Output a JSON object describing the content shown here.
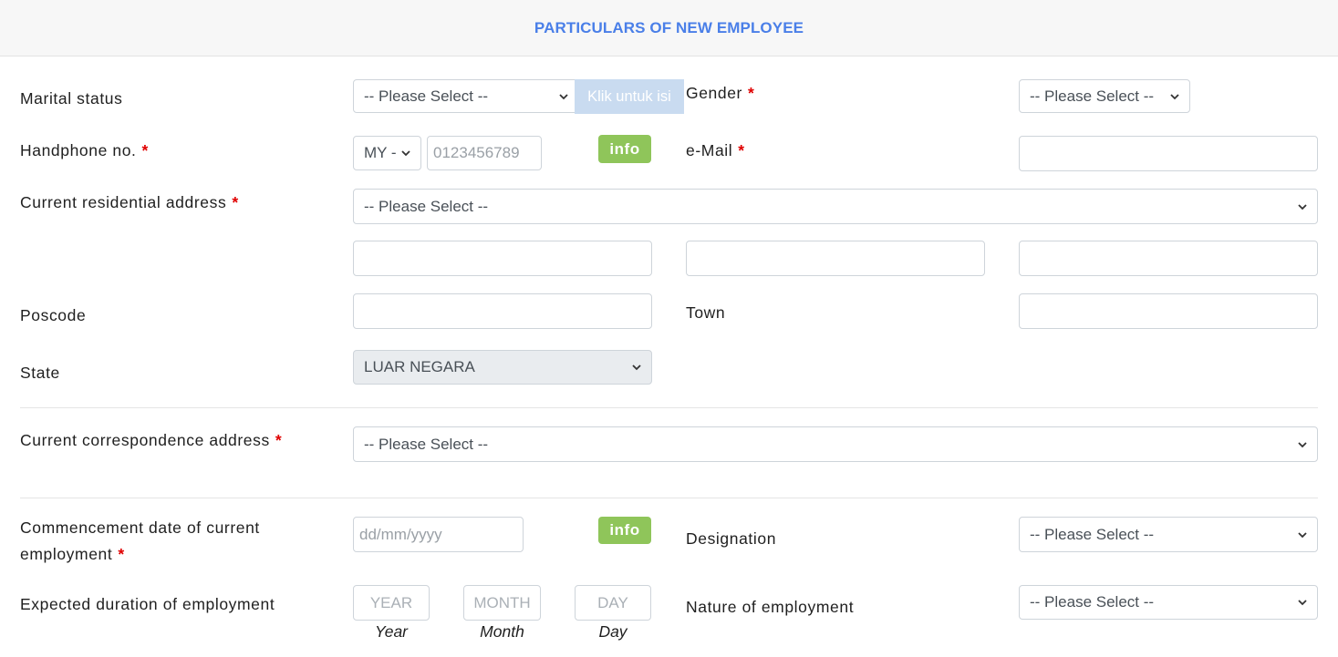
{
  "header": {
    "title": "PARTICULARS OF NEW EMPLOYEE"
  },
  "marital_status": {
    "label": "Marital status",
    "value": "-- Please Select --",
    "tooltip": "Klik untuk isi"
  },
  "gender": {
    "label": "Gender",
    "required": "*",
    "value": "-- Please Select --"
  },
  "handphone": {
    "label": "Handphone no.",
    "required": "*",
    "country": "MY -",
    "placeholder": "0123456789",
    "info": "info"
  },
  "email": {
    "label": "e-Mail",
    "required": "*",
    "value": ""
  },
  "residential": {
    "label": "Current residential address",
    "required": "*",
    "value": "-- Please Select --",
    "line1": "",
    "line2": "",
    "line3": ""
  },
  "poscode": {
    "label": "Poscode",
    "value": ""
  },
  "town": {
    "label": "Town",
    "value": ""
  },
  "state": {
    "label": "State",
    "value": "LUAR NEGARA"
  },
  "correspondence": {
    "label": "Current correspondence address",
    "required": "*",
    "value": "-- Please Select --"
  },
  "commencement": {
    "label_line1": "Commencement date of current",
    "label_line2": "employment",
    "required": "*",
    "placeholder": "dd/mm/yyyy",
    "info": "info"
  },
  "designation": {
    "label": "Designation",
    "value": "-- Please Select --"
  },
  "duration": {
    "label": "Expected duration of employment",
    "year_placeholder": "YEAR",
    "month_placeholder": "MONTH",
    "day_placeholder": "DAY",
    "year_caption": "Year",
    "month_caption": "Month",
    "day_caption": "Day"
  },
  "nature": {
    "label": "Nature of employment",
    "value": "-- Please Select --"
  },
  "colors": {
    "header_text": "#4a7fe8",
    "required": "#e00000",
    "info_badge": "#8fc55a",
    "tooltip": "#c9dbf0"
  }
}
